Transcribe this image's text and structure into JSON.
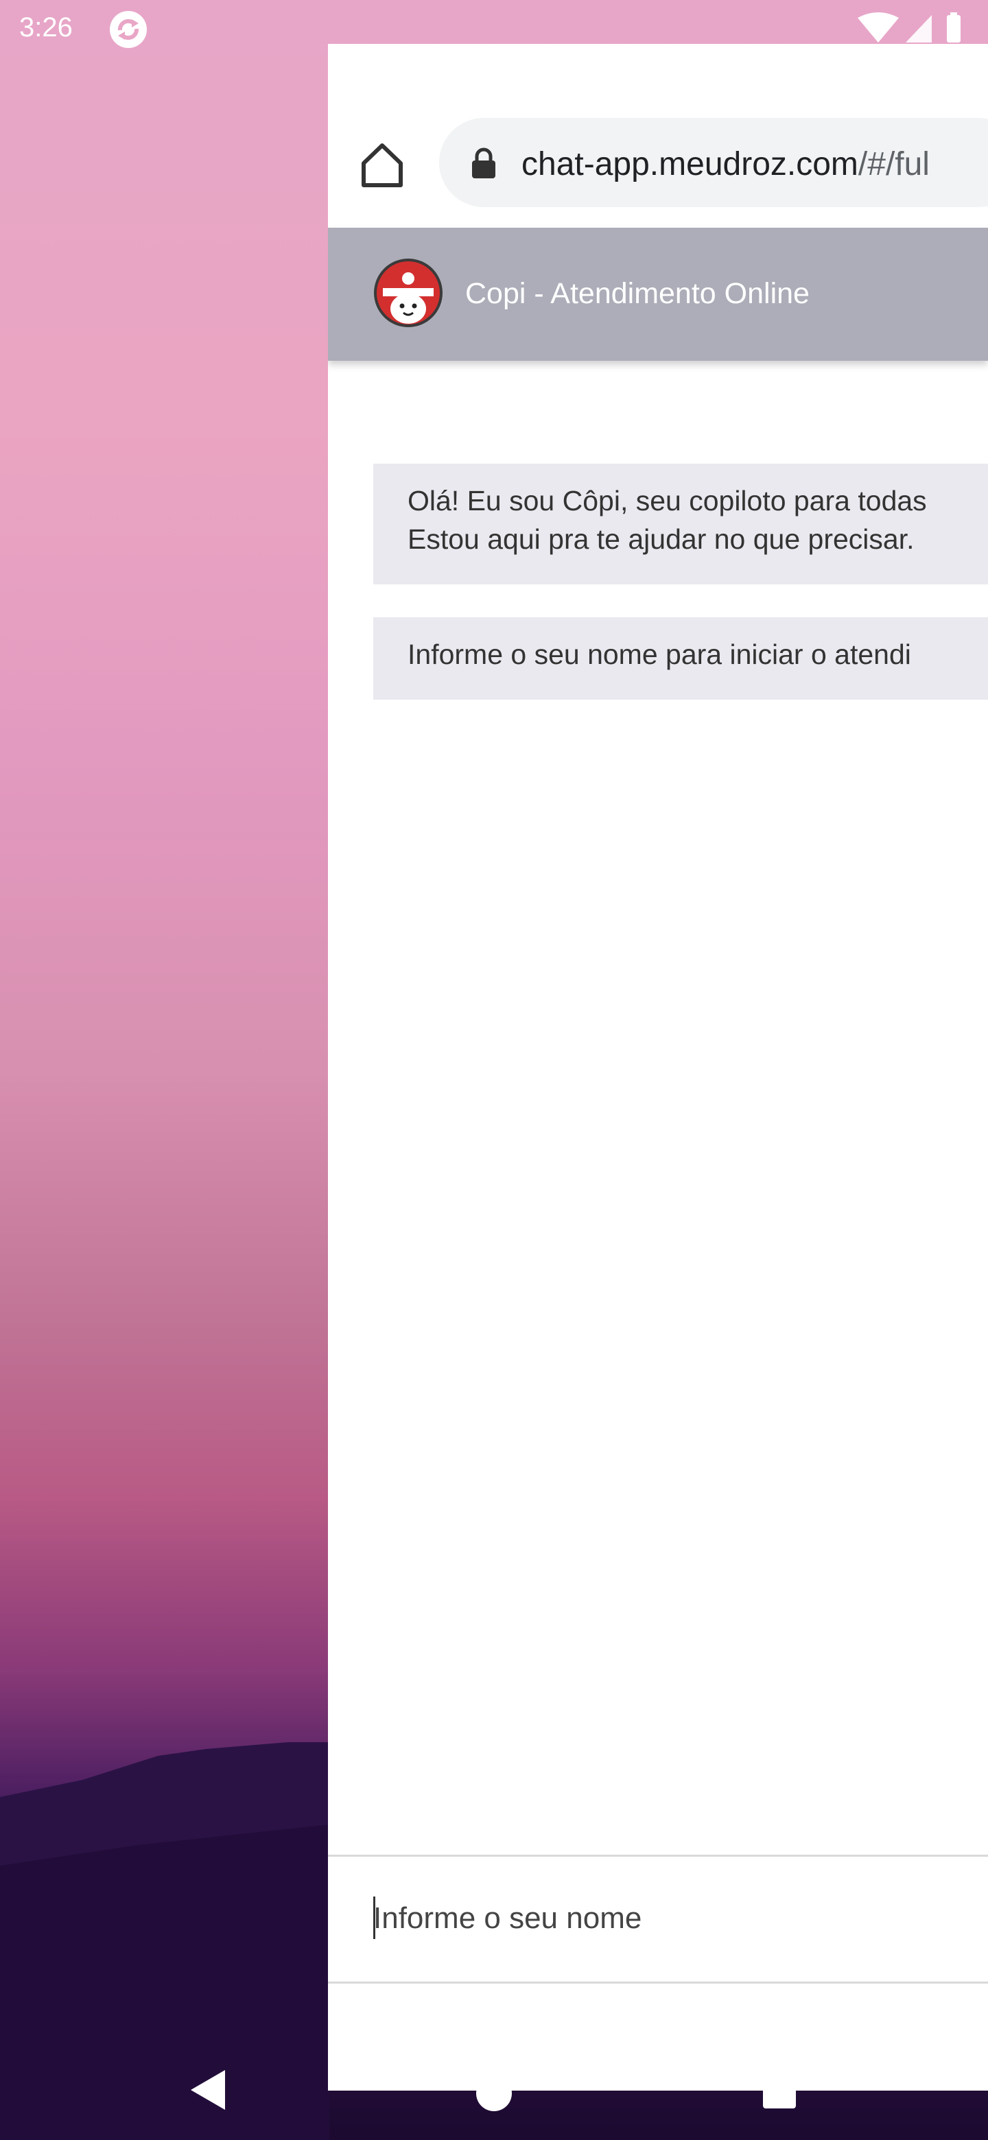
{
  "status_bar": {
    "time": "3:26",
    "icons": [
      "sync-icon",
      "wifi-icon",
      "signal-icon",
      "battery-icon"
    ]
  },
  "browser": {
    "url_domain": "chat-app.meudroz.com",
    "url_path": "/#/ful",
    "icons": [
      "home-icon",
      "lock-icon"
    ]
  },
  "chat": {
    "title": "Copi - Atendimento Online",
    "messages": [
      {
        "line1": "Olá! Eu sou Côpi, seu copiloto para todas",
        "line2": "Estou aqui pra te ajudar no que precisar."
      },
      {
        "line1": "Informe o seu nome para iniciar o atendi"
      }
    ],
    "input": {
      "placeholder": "Informe o seu nome",
      "value": ""
    }
  },
  "colors": {
    "header_bg": "#acadb8",
    "bubble_bg": "#e9e9ef",
    "avatar_red": "#d32f2f"
  },
  "nav_bar": {
    "icons": [
      "back-icon",
      "home-circle-icon",
      "recents-icon"
    ]
  }
}
